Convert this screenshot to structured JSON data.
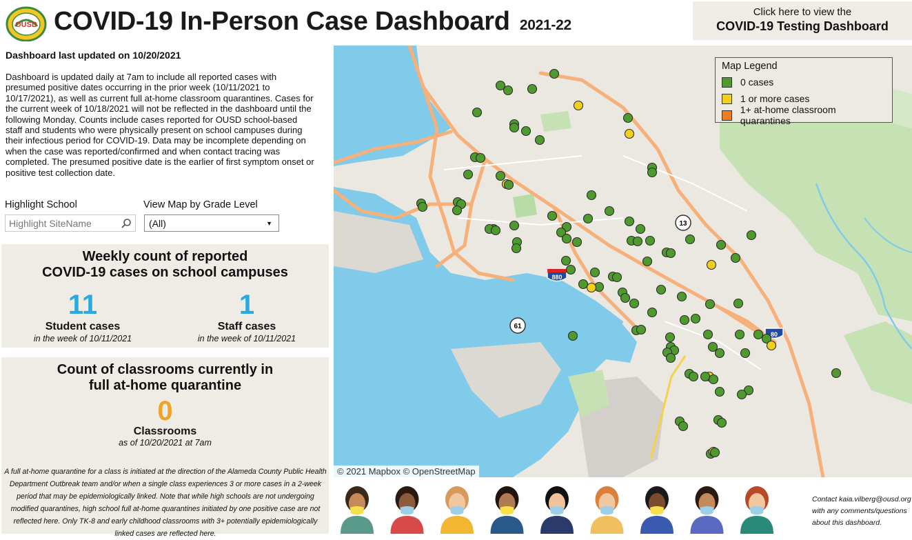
{
  "header": {
    "title": "COVID-19 In-Person Case Dashboard",
    "year": "2021-22",
    "logo_text": "OUSD",
    "testing_button": {
      "line1": "Click here to view the",
      "line2": "COVID-19 Testing Dashboard"
    }
  },
  "left": {
    "updated": "Dashboard last updated on 10/20/2021",
    "description": "Dashboard is updated daily at 7am to include all reported cases with presumed positive dates occurring in the prior week (10/11/2021 to 10/17/2021), as well as current full at-home classroom quarantines. Cases for the current week of 10/18/2021 will not be reflected in the dashboard until the following Monday. Counts include cases reported for OUSD school-based staff and students who were physically present on school campuses during their infectious period for COVID-19. Data may be incomplete depending on when the case was reported/confirmed and when contact tracing was completed. The presumed positive date is the earlier of first symptom onset or positive test collection date.",
    "highlight_label": "Highlight School",
    "highlight_placeholder": "Highlight SiteName",
    "grade_label": "View Map by Grade Level",
    "grade_value": "(All)"
  },
  "weekly": {
    "title_l1": "Weekly count of reported",
    "title_l2": "COVID-19 cases on school campuses",
    "student_count": "11",
    "student_label": "Student cases",
    "student_sub": "in the week of 10/11/2021",
    "staff_count": "1",
    "staff_label": "Staff cases",
    "staff_sub": "in the week of 10/11/2021"
  },
  "quarantine": {
    "title_l1": "Count of classrooms currently in",
    "title_l2": "full at-home quarantine",
    "count": "0",
    "label": "Classrooms",
    "sub": "as of 10/20/2021 at 7am",
    "note": "A full at-home quarantine for a class is initiated at the direction of the Alameda County Public Health Department Outbreak team and/or when a single class experiences 3 or more cases in a 2-week period that may be epidemiologically linked. Note that while high schools are not undergoing modified quarantines, high school full at-home quarantines initiated by one positive case are not reflected here. Only TK-8 and early childhood classrooms with 3+ potentially epidemiologically linked cases are reflected here."
  },
  "map": {
    "legend_title": "Map Legend",
    "legend_items": [
      {
        "label": "0 cases",
        "color": "#4e9a2f"
      },
      {
        "label": "1 or more cases",
        "color": "#f2cf1c"
      },
      {
        "label": "1+ at-home classroom quarantines",
        "color": "#ee7d22"
      }
    ],
    "attribution": "© 2021 Mapbox  © OpenStreetMap",
    "shields": [
      "13",
      "880",
      "61",
      "80"
    ],
    "school_status": [
      0,
      0,
      0,
      0,
      1,
      0,
      0,
      0,
      0,
      0,
      0,
      1,
      0,
      0,
      0,
      0,
      0,
      0,
      1,
      0,
      0,
      0,
      0,
      0,
      0,
      0,
      0,
      0,
      0,
      0,
      0,
      0,
      0,
      0,
      0,
      0,
      0,
      0,
      0,
      0,
      0,
      0,
      0,
      0,
      0,
      0,
      0,
      0,
      0,
      0,
      1,
      0,
      0,
      0,
      0,
      0,
      1,
      0,
      0,
      0,
      0,
      0,
      0,
      0,
      0,
      0,
      0,
      0,
      0,
      0,
      0,
      0,
      0,
      0,
      0,
      0,
      0,
      1,
      0,
      0,
      0,
      0,
      0,
      1,
      0,
      0,
      0,
      0,
      0,
      0,
      0,
      0,
      0,
      0,
      0,
      0,
      1,
      0,
      0,
      0,
      0
    ]
  },
  "footer": {
    "contact": [
      "Contact kaia.vilberg@ousd.org",
      "with any comments/questions",
      "about this dashboard."
    ],
    "avatar_names": [
      "avatar-1",
      "avatar-2",
      "avatar-3",
      "avatar-4",
      "avatar-5",
      "avatar-6",
      "avatar-7",
      "avatar-8",
      "avatar-9"
    ]
  }
}
